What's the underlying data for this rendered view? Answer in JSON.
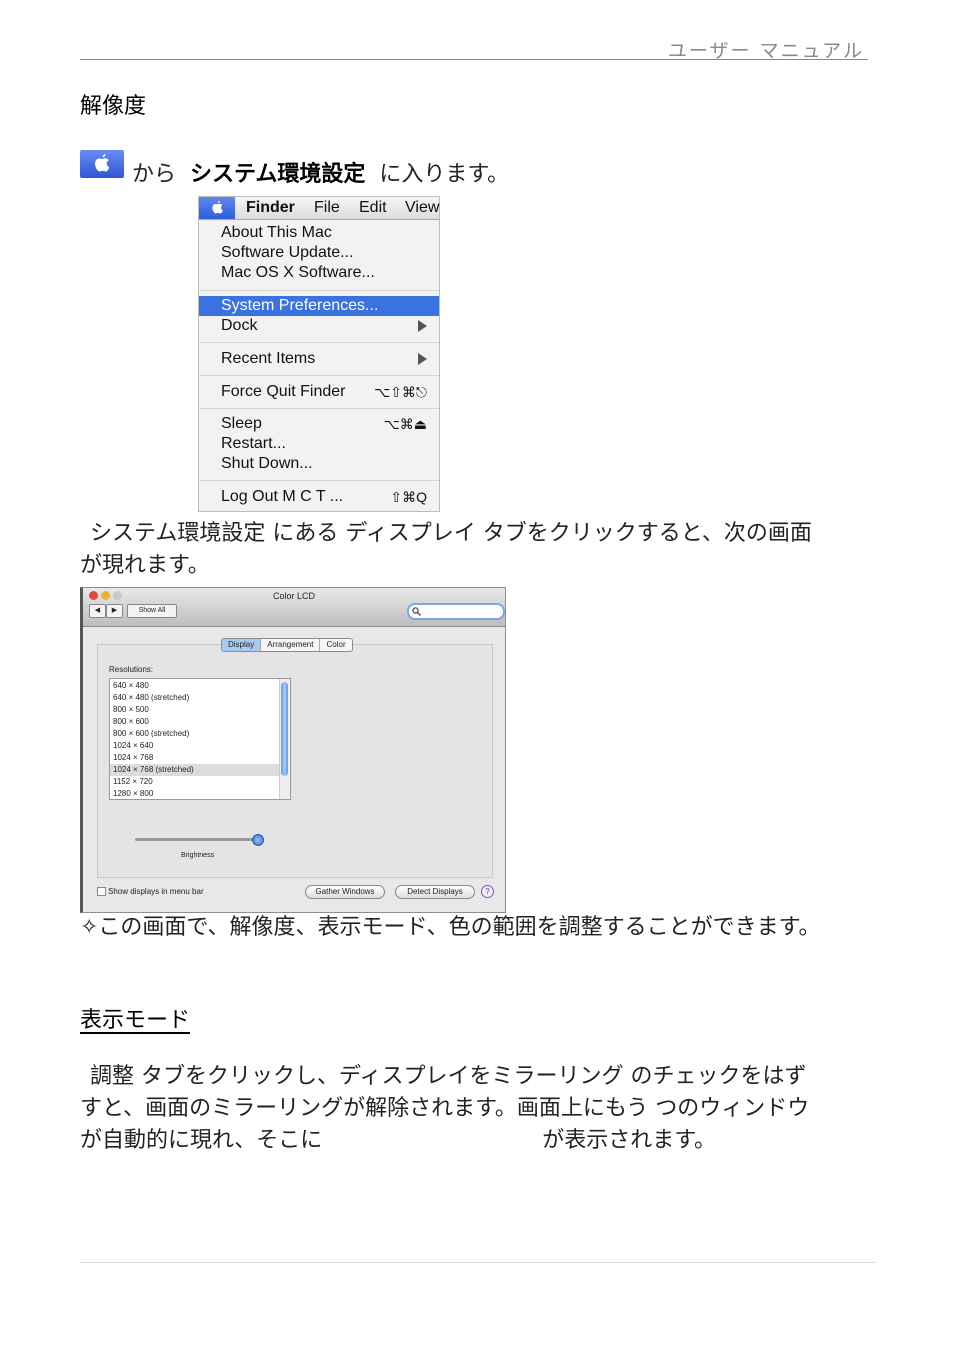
{
  "header": {
    "title": "ユーザー マニュアル"
  },
  "section1": {
    "heading": "解像度",
    "intro_from": "から",
    "intro_target": "システム環境設定",
    "intro_tail": "に入ります。"
  },
  "apple_menu": {
    "bar": [
      "Finder",
      "File",
      "Edit",
      "View"
    ],
    "items": {
      "about": "About This Mac",
      "update": "Software Update...",
      "macos": "Mac OS X Software...",
      "prefs": "System Preferences...",
      "dock": "Dock",
      "recent": "Recent Items",
      "force_quit": "Force Quit Finder",
      "force_quit_shortcut": "⌥⇧⌘⎋",
      "sleep": "Sleep",
      "sleep_shortcut": "⌥⌘⏏",
      "restart": "Restart...",
      "shutdown": "Shut Down...",
      "logout": "Log Out M C T ...",
      "logout_shortcut": "⇧⌘Q"
    }
  },
  "para1": {
    "line1": "システム環境設定 にある ディスプレイ タブをクリックすると、次の画面",
    "line2": "が現れます。"
  },
  "display_window": {
    "title": "Color LCD",
    "show_all": "Show All",
    "tabs": [
      "Display",
      "Arrangement",
      "Color"
    ],
    "resolutions_label": "Resolutions:",
    "resolutions": [
      "640 × 480",
      "640 × 480 (stretched)",
      "800 × 500",
      "800 × 600",
      "800 × 600 (stretched)",
      "1024 × 640",
      "1024 × 768",
      "1024 × 768 (stretched)",
      "1152 × 720",
      "1280 × 800"
    ],
    "selected_resolution": "1024 × 768 (stretched)",
    "brightness_label": "Brightness",
    "brightness_level": 0.95,
    "show_in_menu_bar": "Show displays in menu bar",
    "gather_windows": "Gather Windows",
    "detect_displays": "Detect Displays",
    "help": "?"
  },
  "note": "✧この画面で、解像度、表示モード、色の範囲を調整することができます。",
  "section2": {
    "heading": "表示モード",
    "line1": "調整 タブをクリックし、ディスプレイをミラーリング のチェックをはず",
    "line2": "すと、画面のミラーリングが解除されます。画面上にもう つのウィンドウ",
    "line3_a": "が自動的に現れ、そこに",
    "line3_b": "が表示されます。"
  }
}
